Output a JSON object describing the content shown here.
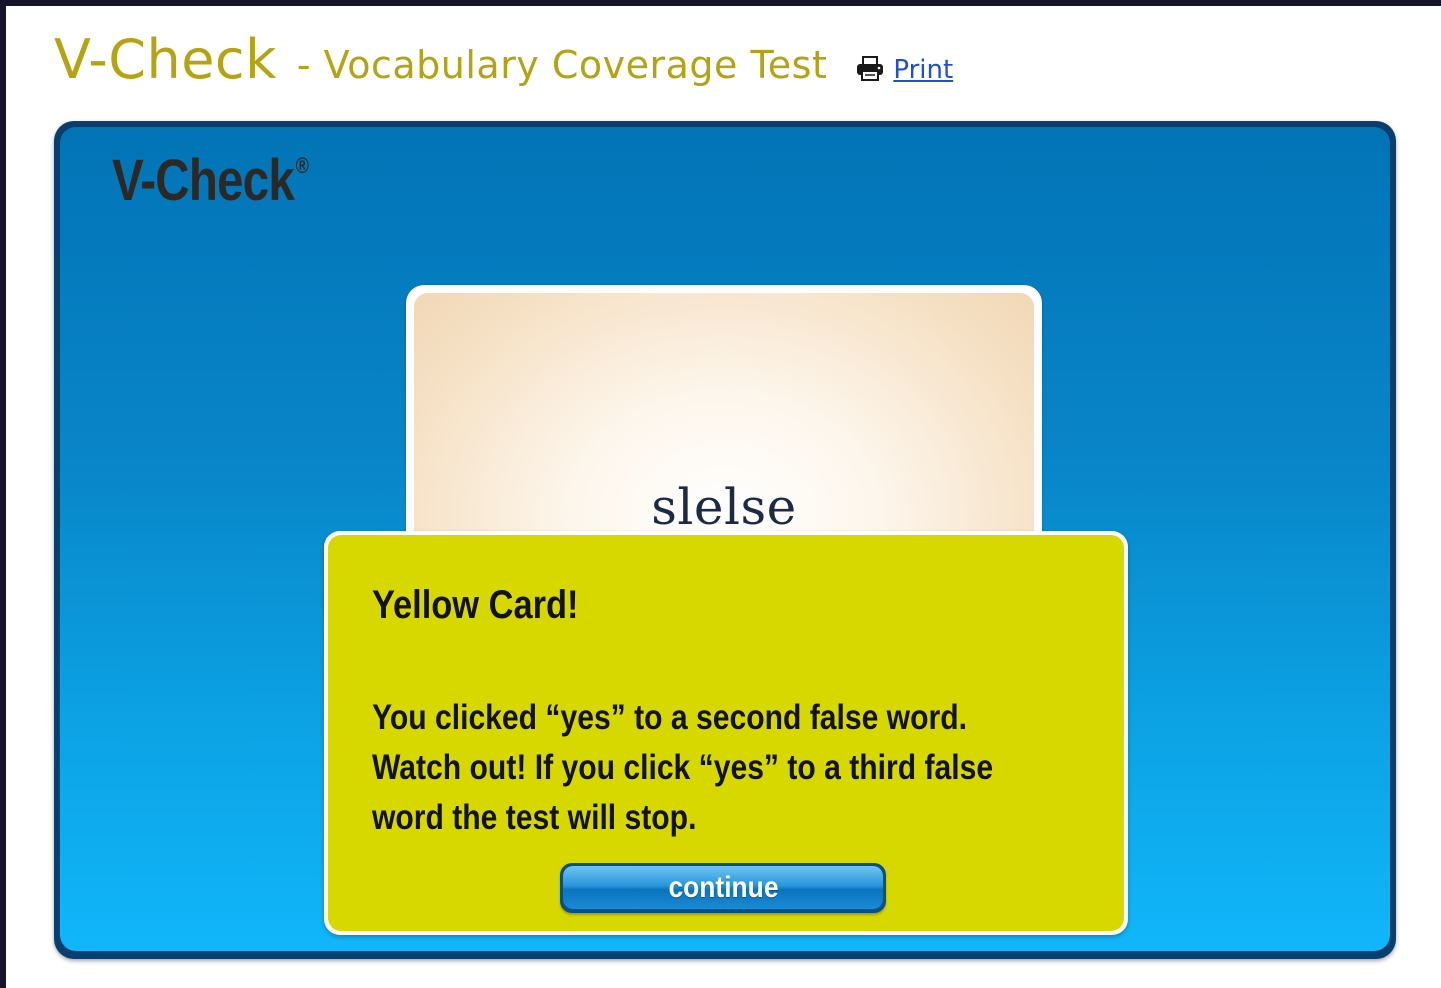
{
  "header": {
    "title": "V-Check",
    "subtitle": "- Vocabulary Coverage Test",
    "print_label": "Print",
    "print_icon": "printer-icon"
  },
  "panel": {
    "brand": "V-Check",
    "brand_mark": "®"
  },
  "word_card": {
    "word": "slelse"
  },
  "yellow_card": {
    "title": "Yellow Card!",
    "message_lines": [
      "You clicked “yes” to a second false word.",
      "Watch out! If you click “yes” to a third false",
      "word the test will stop."
    ],
    "continue_label": "continue"
  },
  "colors": {
    "title_olive": "#b5a311",
    "link_blue": "#1f4fd9",
    "panel_blue": "#0885c8",
    "card_yellow": "#d7d800",
    "button_blue": "#1a8ad3"
  }
}
